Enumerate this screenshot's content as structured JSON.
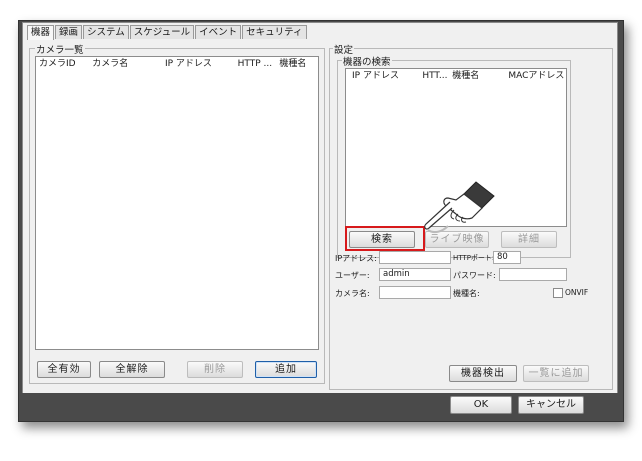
{
  "tabs": [
    {
      "label": "機器",
      "active": true
    },
    {
      "label": "録画",
      "active": false
    },
    {
      "label": "システム",
      "active": false
    },
    {
      "label": "スケジュール",
      "active": false
    },
    {
      "label": "イベント",
      "active": false
    },
    {
      "label": "セキュリティ",
      "active": false
    }
  ],
  "camera_list": {
    "title": "カメラ一覧",
    "columns": [
      "カメラID",
      "カメラ名",
      "IP アドレス",
      "HTTP ...",
      "機種名"
    ],
    "rows": []
  },
  "camera_list_buttons": {
    "enable_all": "全有効",
    "disable_all": "全解除",
    "delete": "削除",
    "add": "追加"
  },
  "settings": {
    "title": "設定",
    "search_group": "機器の検索",
    "columns": [
      "IP アドレス",
      "HTT...",
      "機種名",
      "MACアドレス"
    ],
    "rows": [],
    "search_button": "検索",
    "live_button": "ライブ映像",
    "detail_button": "詳細",
    "ip_label": "IPアドレス:",
    "ip_value": "",
    "http_port_label": "HTTPポート:",
    "http_port_value": "80",
    "user_label": "ユーザー:",
    "user_value": "admin",
    "password_label": "パスワード:",
    "password_value": "",
    "camera_name_label": "カメラ名:",
    "camera_name_value": "",
    "model_label": "機種名:",
    "onvif_label": "ONVIF",
    "onvif_checked": false,
    "detect_button": "機器検出",
    "add_to_list_button": "一覧に追加"
  },
  "footer": {
    "ok": "OK",
    "cancel": "キャンセル"
  },
  "colors": {
    "highlight": "#d7191b",
    "frame_dark": "#4a4a4a",
    "dialog_bg": "#f0f0f0"
  },
  "icons": {
    "pointer": "pointing-hand-icon"
  }
}
